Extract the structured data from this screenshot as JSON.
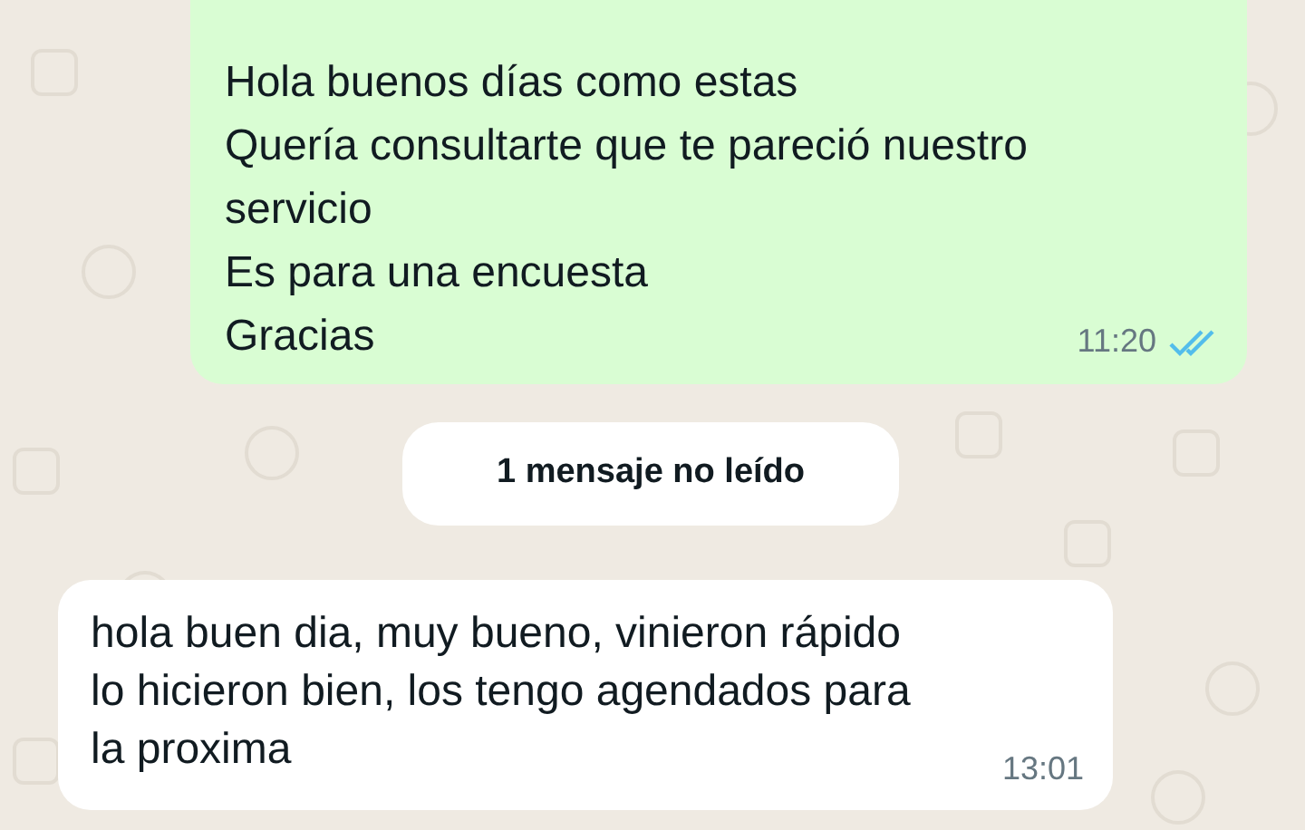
{
  "messages": [
    {
      "kind": "outgoing",
      "text": "Hola buenos días como estas\nQuería consultarte que te pareció nuestro servicio\nEs para una encuesta\nGracias",
      "time": "11:20",
      "read": true
    },
    {
      "kind": "unread_banner",
      "text": "1 mensaje no leído"
    },
    {
      "kind": "incoming",
      "text": "hola buen dia, muy bueno, vinieron rápido lo hicieron bien, los tengo agendados para la proxima",
      "time": "13:01"
    }
  ]
}
